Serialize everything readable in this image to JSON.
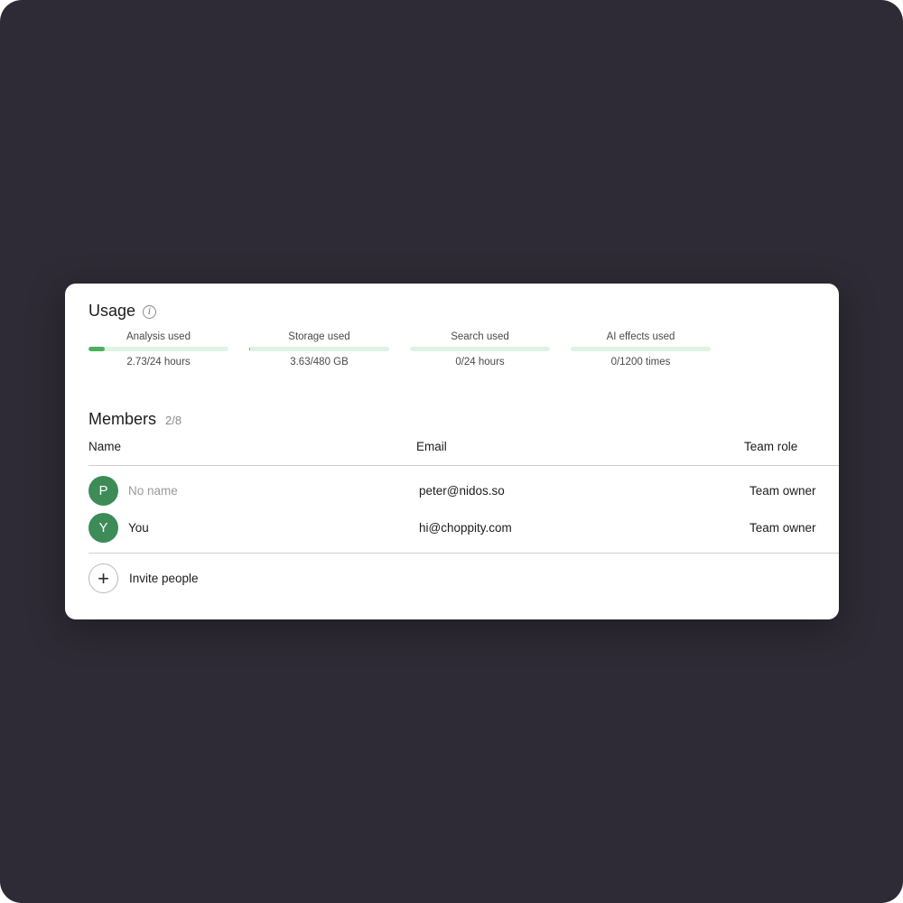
{
  "usage": {
    "title": "Usage",
    "info_icon": "info-icon",
    "metrics": [
      {
        "label": "Analysis used",
        "value": "2.73/24 hours",
        "fraction": 0.114
      },
      {
        "label": "Storage used",
        "value": "3.63/480 GB",
        "fraction": 0.008
      },
      {
        "label": "Search used",
        "value": "0/24 hours",
        "fraction": 0
      },
      {
        "label": "AI effects used",
        "value": "0/1200 times",
        "fraction": 0
      }
    ]
  },
  "members": {
    "title": "Members",
    "count": "2/8",
    "columns": {
      "name": "Name",
      "email": "Email",
      "role": "Team role"
    },
    "rows": [
      {
        "initial": "P",
        "name": "No name",
        "email": "peter@nidos.so",
        "role": "Team owner"
      },
      {
        "initial": "Y",
        "name": "You",
        "email": "hi@choppity.com",
        "role": "Team owner"
      }
    ],
    "invite_label": "Invite people",
    "invite_icon": "plus-icon"
  },
  "colors": {
    "background": "#2e2b36",
    "card": "#ffffff",
    "bar_track": "#dff3e2",
    "bar_fill": "#4caf5f",
    "avatar": "#3d8b57"
  }
}
